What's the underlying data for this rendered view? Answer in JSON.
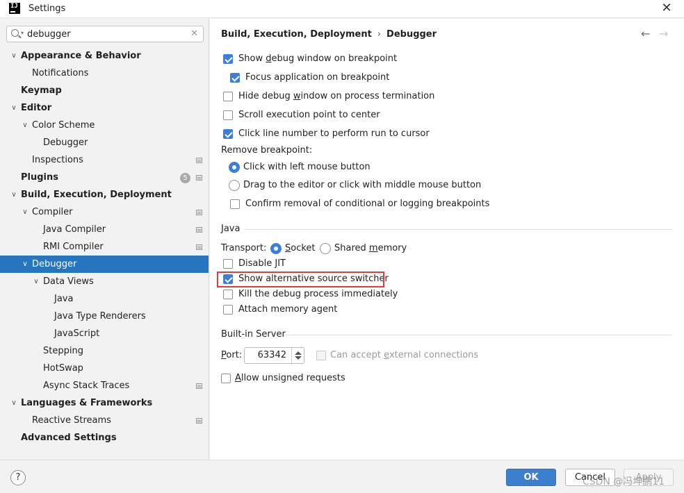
{
  "window": {
    "title": "Settings"
  },
  "search": {
    "value": "debugger",
    "placeholder": ""
  },
  "sidebar": {
    "items": [
      {
        "label": "Appearance & Behavior"
      },
      {
        "label": "Notifications"
      },
      {
        "label": "Keymap"
      },
      {
        "label": "Editor"
      },
      {
        "label": "Color Scheme"
      },
      {
        "label": "Debugger"
      },
      {
        "label": "Inspections"
      },
      {
        "label": "Plugins",
        "badge": "5"
      },
      {
        "label": "Build, Execution, Deployment"
      },
      {
        "label": "Compiler"
      },
      {
        "label": "Java Compiler"
      },
      {
        "label": "RMI Compiler"
      },
      {
        "label": "Debugger"
      },
      {
        "label": "Data Views"
      },
      {
        "label": "Java"
      },
      {
        "label": "Java Type Renderers"
      },
      {
        "label": "JavaScript"
      },
      {
        "label": "Stepping"
      },
      {
        "label": "HotSwap"
      },
      {
        "label": "Async Stack Traces"
      },
      {
        "label": "Languages & Frameworks"
      },
      {
        "label": "Reactive Streams"
      },
      {
        "label": "Advanced Settings"
      }
    ]
  },
  "breadcrumb": {
    "parent": "Build, Execution, Deployment",
    "separator": "›",
    "current": "Debugger"
  },
  "options": {
    "show_debug_window": {
      "pre": "Show ",
      "mnemonic": "d",
      "post": "ebug window on breakpoint",
      "checked": true
    },
    "focus_app": {
      "label": "Focus application on breakpoint",
      "checked": true
    },
    "hide_debug_window": {
      "pre": "Hide debug ",
      "mnemonic": "w",
      "post": "indow on process termination",
      "checked": false
    },
    "scroll_exec": {
      "label": "Scroll execution point to center",
      "checked": false
    },
    "click_line": {
      "label": "Click line number to perform run to cursor",
      "checked": true
    },
    "remove_bp_label": "Remove breakpoint:",
    "remove_left": {
      "label": "Click with left mouse button",
      "selected": true
    },
    "remove_drag": {
      "label": "Drag to the editor or click with middle mouse button",
      "selected": false
    },
    "confirm_removal": {
      "label": "Confirm removal of conditional or logging breakpoints",
      "checked": false
    }
  },
  "java": {
    "section": "Java",
    "transport_label": "Transport:",
    "socket": {
      "mnemonic": "S",
      "post": "ocket",
      "selected": true
    },
    "shared_memory": {
      "pre": "Shared ",
      "mnemonic": "m",
      "post": "emory",
      "selected": false
    },
    "disable_jit": {
      "label": "Disable JIT",
      "checked": false
    },
    "alt_source": {
      "label": "Show alternative source switcher",
      "checked": true
    },
    "kill_debug": {
      "label": "Kill the debug process immediately",
      "checked": false
    },
    "attach_memory": {
      "label": "Attach memory agent",
      "checked": false
    }
  },
  "server": {
    "section": "Built-in Server",
    "port_mnemonic": "P",
    "port_post": "ort:",
    "port_value": "63342",
    "external_pre": "Can accept ",
    "external_mnemonic": "e",
    "external_post": "xternal connections",
    "unsigned_mnemonic": "A",
    "unsigned_post": "llow unsigned requests"
  },
  "footer": {
    "help": "?",
    "ok": "OK",
    "cancel": "Cancel",
    "apply": "Apply",
    "watermark": "CSDN @冯坤鹏11"
  },
  "colors": {
    "accent": "#2675bf",
    "highlight_border": "#e03a3a"
  }
}
